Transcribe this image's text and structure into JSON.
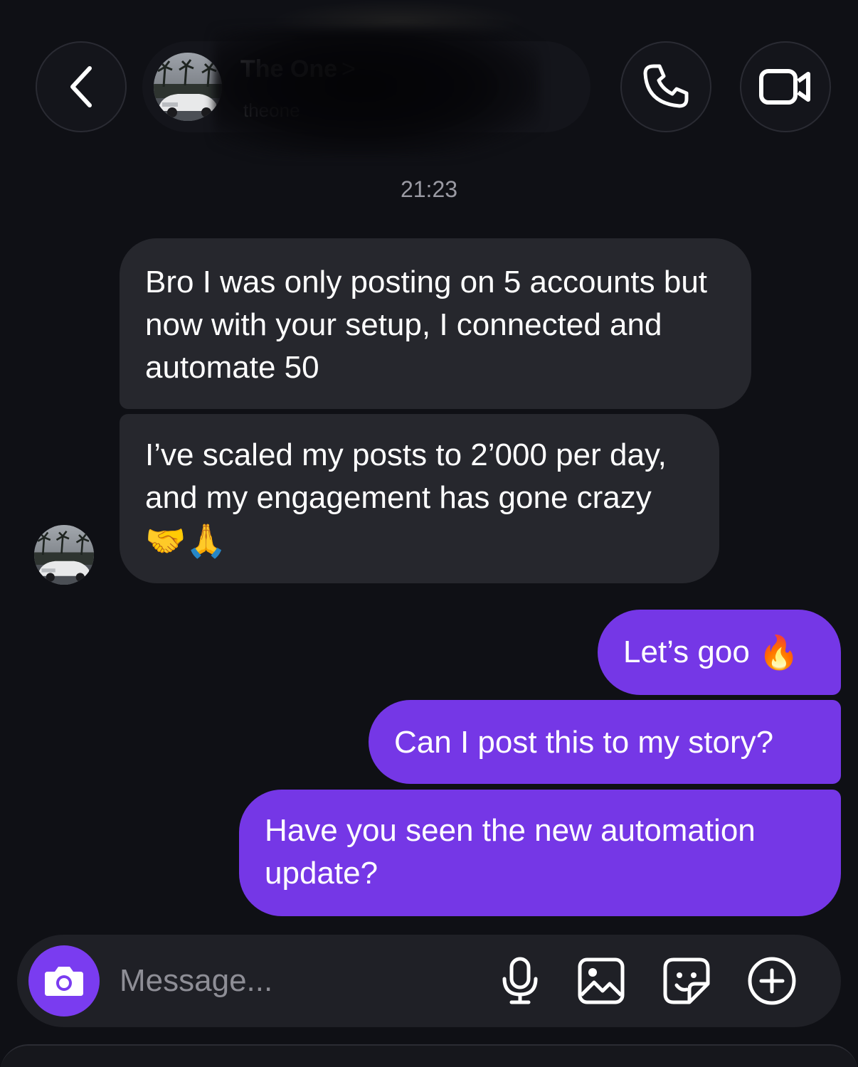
{
  "header": {
    "contact_name": "The One",
    "name_chevron": ">",
    "contact_username": "theone",
    "icons": {
      "back": "chevron-left-icon",
      "call": "phone-icon",
      "video": "video-camera-icon"
    }
  },
  "thread": {
    "timestamp": "21:23",
    "incoming": [
      {
        "text": "Bro I was only posting on 5 accounts but now with your setup, I connected and automate 50"
      },
      {
        "text": "I’ve scaled my posts to 2’000 per day, and my engagement has gone crazy",
        "emojis": "🤝🙏"
      }
    ],
    "outgoing": [
      {
        "text": "Let’s goo",
        "emoji": "🔥"
      },
      {
        "text": "Can I post this to my story?"
      },
      {
        "text": "Have you seen the new automation update?"
      }
    ]
  },
  "composer": {
    "placeholder": "Message...",
    "value": "",
    "icons": {
      "camera": "camera-icon",
      "mic": "microphone-icon",
      "gallery": "image-icon",
      "sticker": "sticker-icon",
      "plus": "plus-circle-icon"
    }
  },
  "colors": {
    "background": "#0f1015",
    "incoming_bubble": "#26272d",
    "outgoing_bubble": "#7537e6",
    "accent": "#7a3cf0"
  }
}
